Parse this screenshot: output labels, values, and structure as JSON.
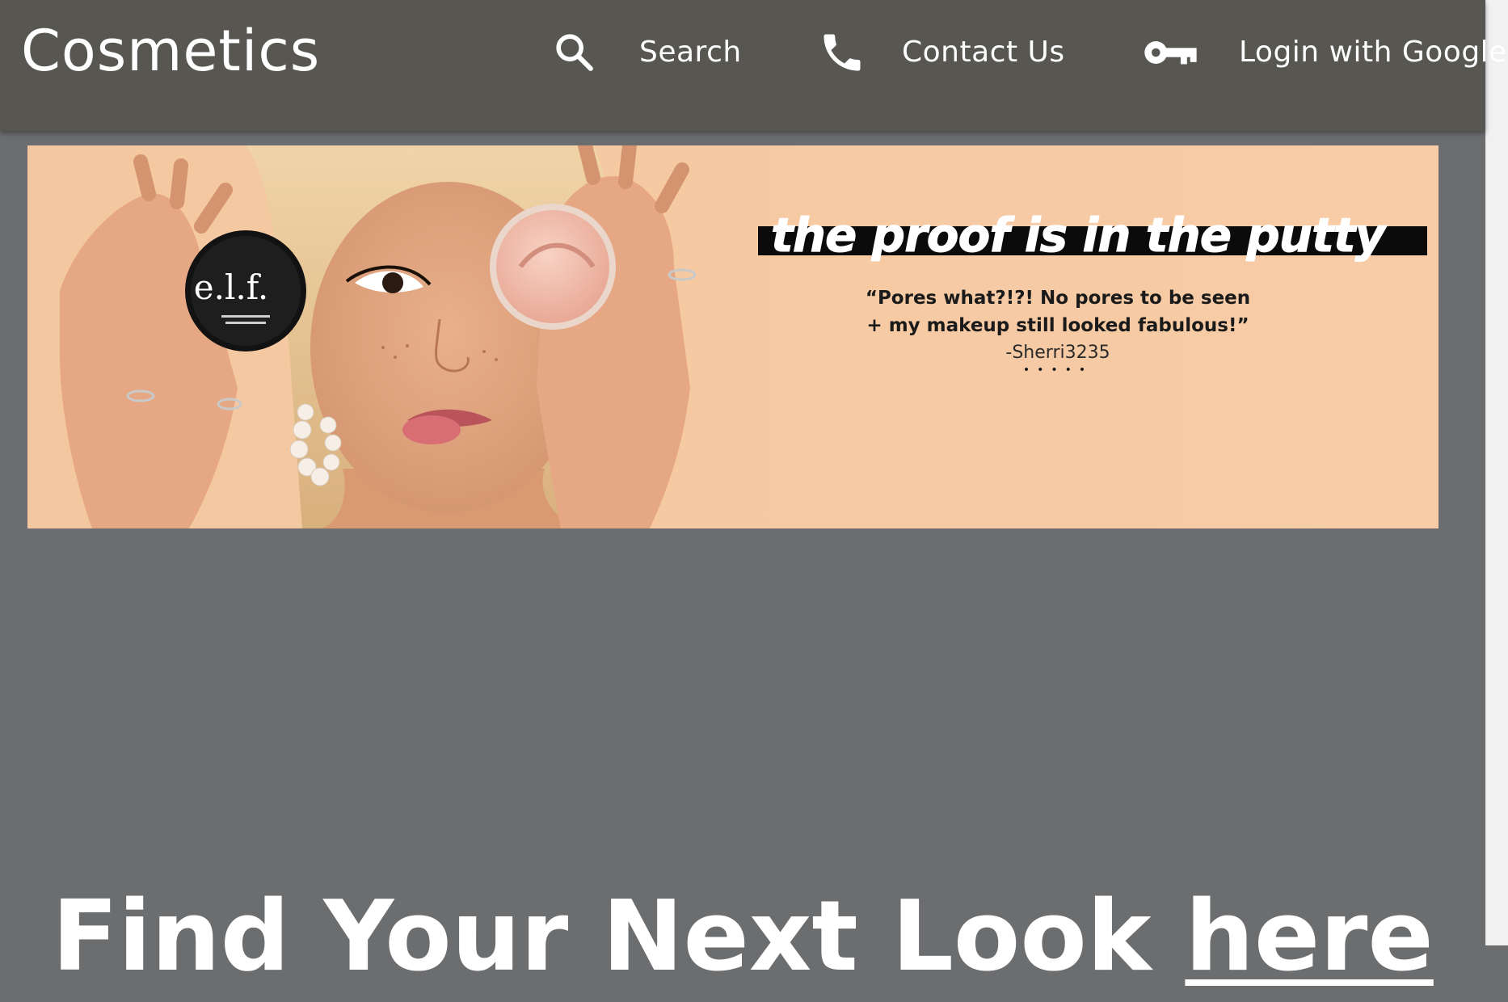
{
  "header": {
    "brand": "Cosmetics",
    "nav": [
      {
        "label": "Search",
        "icon": "search-icon"
      },
      {
        "label": "Contact Us",
        "icon": "phone-icon"
      },
      {
        "label": "Login with Google",
        "icon": "key-icon"
      }
    ]
  },
  "banner": {
    "product_brand": "e.l.f.",
    "tagline": "the proof is in the putty",
    "quote_line1": "“Pores what?!?! No pores to be seen",
    "quote_line2": "+ my makeup still looked fabulous!”",
    "author": "-Sherri3235",
    "rating_stars": "•••••"
  },
  "headline": {
    "text": "Find Your Next Look ",
    "link_text": "here"
  },
  "colors": {
    "topbar": "#585650",
    "page_background": "#6c6d6f",
    "banner_background": "#f5c9a2",
    "text_light": "#ffffff"
  }
}
